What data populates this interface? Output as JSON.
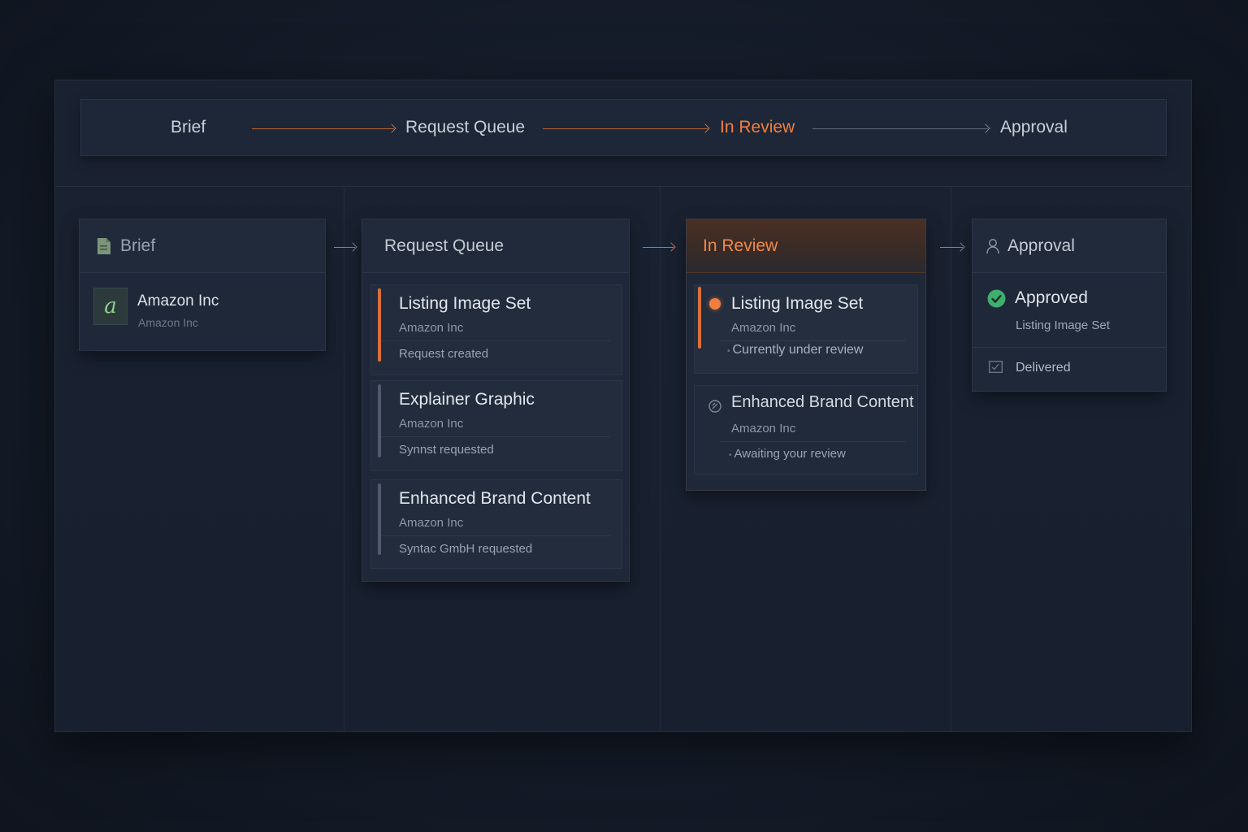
{
  "pipeline": {
    "steps": [
      "Brief",
      "Request Queue",
      "In Review",
      "Approval"
    ],
    "active_step": "In Review"
  },
  "columns": {
    "brief": {
      "title": "Brief",
      "icon": "document-icon",
      "client": {
        "name": "Amazon Inc",
        "sub": "Amazon Inc",
        "logo": "a"
      }
    },
    "queue": {
      "title": "Request Queue",
      "cards": [
        {
          "title": "Listing Image Set",
          "company": "Amazon Inc",
          "status": "Request created"
        },
        {
          "title": "Explainer Graphic",
          "company": "Amazon Inc",
          "status": "Synnst requested"
        },
        {
          "title": "Enhanced Brand Content",
          "company": "Amazon Inc",
          "status": "Syntac GmbH requested"
        }
      ]
    },
    "review": {
      "title": "In Review",
      "cards": [
        {
          "title": "Listing Image Set",
          "company": "Amazon Inc",
          "status": "Currently under review"
        },
        {
          "title": "Enhanced Brand Content",
          "company": "Amazon Inc",
          "status": "Awaiting your review"
        }
      ]
    },
    "approval": {
      "title": "Approval",
      "icon": "user-icon",
      "approved_label": "Approved",
      "approved_item": "Listing Image Set",
      "delivered_label": "Delivered"
    }
  },
  "colors": {
    "accent": "#f07f3f",
    "approved": "#3fae6f",
    "background": "#151c29"
  }
}
